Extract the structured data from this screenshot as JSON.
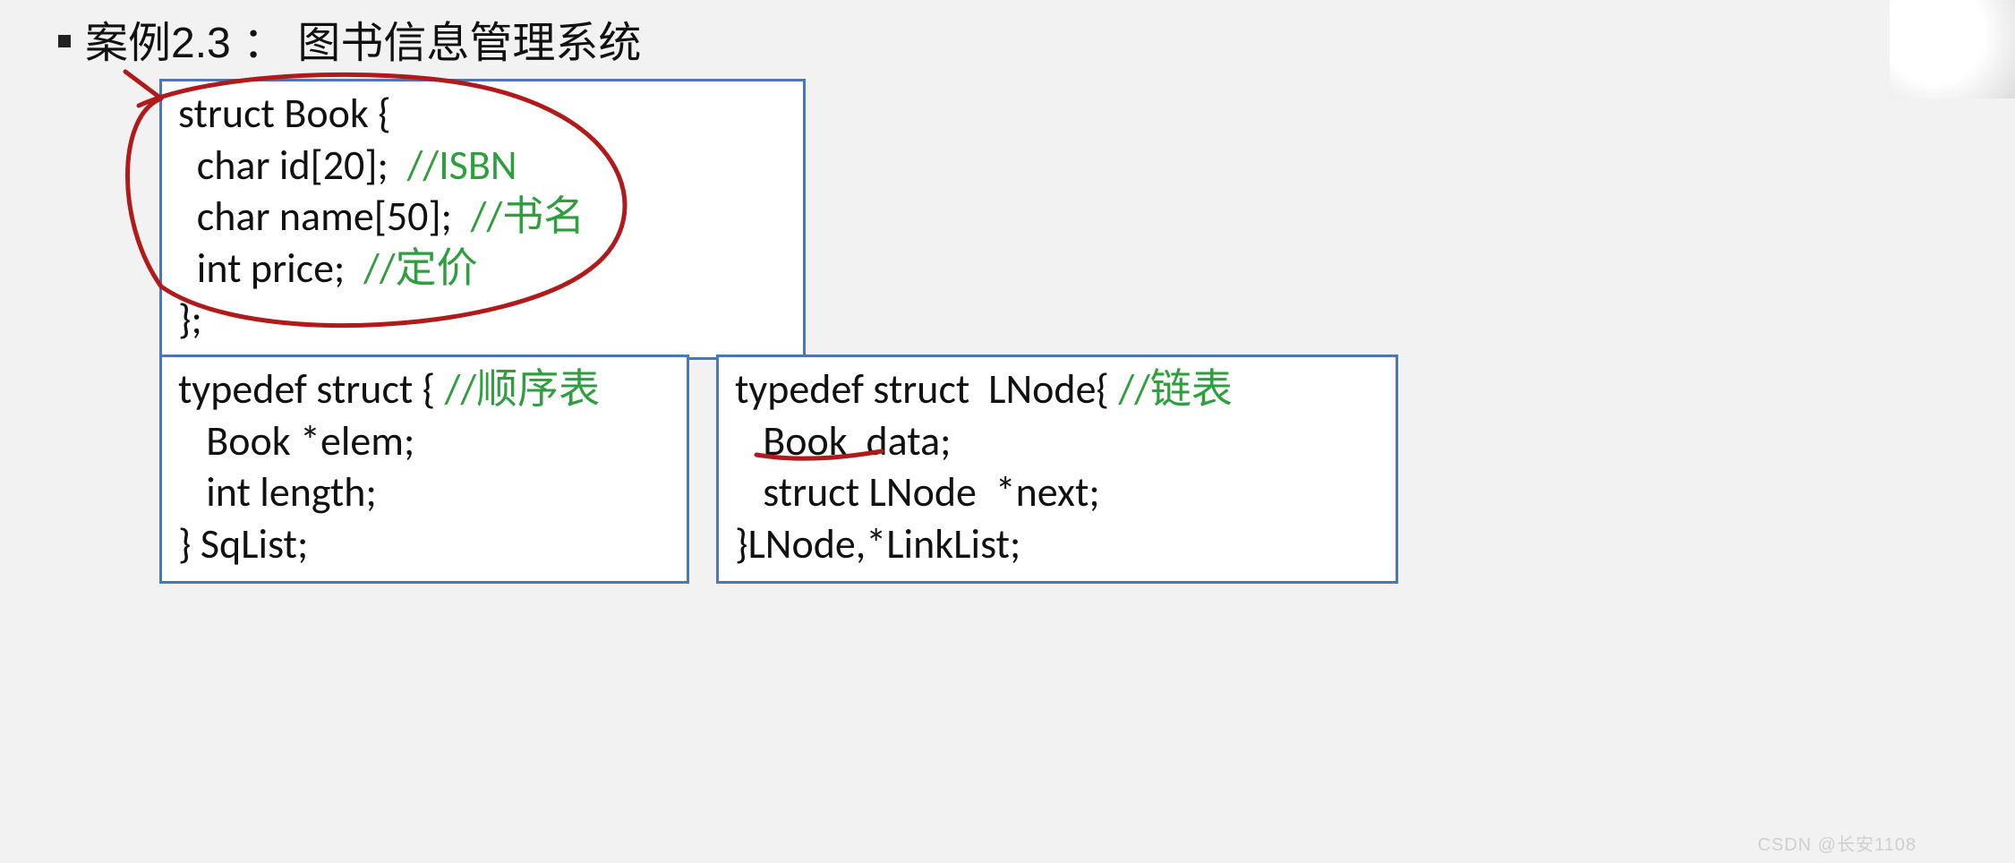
{
  "title": "案例2.3 ： 图书信息管理系统",
  "code_book": {
    "l1": "struct Book {",
    "l2a": "  char id[20];  ",
    "l2b": "//ISBN",
    "l3a": "  char name[50];  ",
    "l3b": "//书名",
    "l4a": "  int price;  ",
    "l4b": "//定价",
    "l5": "};"
  },
  "code_sqlist": {
    "l1a": "typedef struct { ",
    "l1b": "//顺序表",
    "l2": "   Book *elem;",
    "l3": "   int length;",
    "l4": "} SqList;"
  },
  "code_lnode": {
    "l1a": "typedef struct  LNode{ ",
    "l1b": "//链表",
    "l2": "   Book  data;",
    "l3": "   struct LNode  *next;",
    "l4": "}LNode,*LinkList;"
  },
  "watermark": "CSDN @长安1108"
}
